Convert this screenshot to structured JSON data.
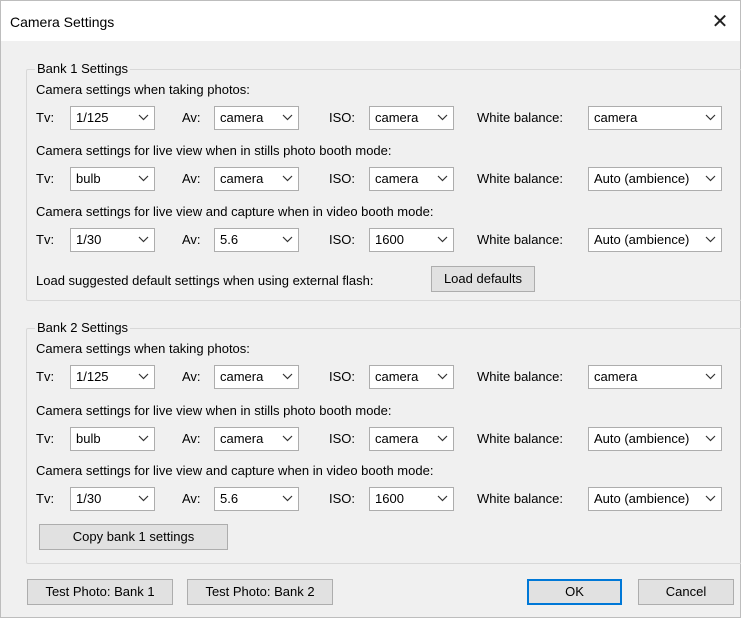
{
  "window": {
    "title": "Camera Settings",
    "close_glyph": "✕"
  },
  "banks": [
    {
      "title": "Bank 1 Settings",
      "rows": [
        {
          "heading": "Camera settings when taking photos:",
          "tv": "1/125",
          "av": "camera",
          "iso": "camera",
          "wb": "camera"
        },
        {
          "heading": "Camera settings for live view when in stills photo booth mode:",
          "tv": "bulb",
          "av": "camera",
          "iso": "camera",
          "wb": "Auto (ambience)"
        },
        {
          "heading": "Camera settings for live view and capture when in video booth mode:",
          "tv": "1/30",
          "av": "5.6",
          "iso": "1600",
          "wb": "Auto (ambience)"
        }
      ],
      "load_text": "Load suggested default settings when using external flash:",
      "load_button": "Load defaults"
    },
    {
      "title": "Bank 2 Settings",
      "rows": [
        {
          "heading": "Camera settings when taking photos:",
          "tv": "1/125",
          "av": "camera",
          "iso": "camera",
          "wb": "camera"
        },
        {
          "heading": "Camera settings for live view when in stills photo booth mode:",
          "tv": "bulb",
          "av": "camera",
          "iso": "camera",
          "wb": "Auto (ambience)"
        },
        {
          "heading": "Camera settings for live view and capture when in video booth mode:",
          "tv": "1/30",
          "av": "5.6",
          "iso": "1600",
          "wb": "Auto (ambience)"
        }
      ],
      "copy_button": "Copy bank 1 settings"
    }
  ],
  "labels": {
    "tv": "Tv:",
    "av": "Av:",
    "iso": "ISO:",
    "wb": "White balance:"
  },
  "footer": {
    "test_bank1": "Test Photo: Bank 1",
    "test_bank2": "Test Photo: Bank 2",
    "ok": "OK",
    "cancel": "Cancel"
  },
  "colors": {
    "accent": "#0078d7",
    "dialog_bg": "#f0f0f0",
    "button_bg": "#e1e1e1",
    "border": "#adadad"
  }
}
